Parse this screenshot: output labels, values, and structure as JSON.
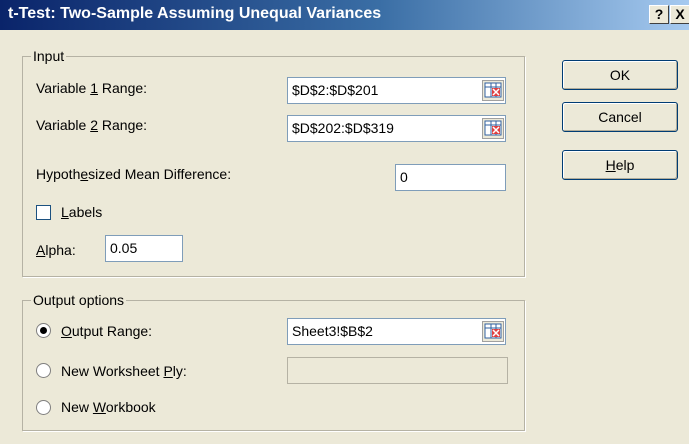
{
  "window": {
    "title": "t-Test: Two-Sample Assuming Unequal Variances",
    "help_glyph": "?",
    "close_glyph": "X"
  },
  "input": {
    "legend": "Input",
    "var1": {
      "pre": "Variable ",
      "key": "1",
      "post": " Range:",
      "value": "$D$2:$D$201"
    },
    "var2": {
      "pre": "Variable ",
      "key": "2",
      "post": " Range:",
      "value": "$D$202:$D$319"
    },
    "hyp": {
      "pre": "Hypoth",
      "key": "e",
      "post": "sized Mean Difference:",
      "value": "0"
    },
    "labels": {
      "key": "L",
      "post": "abels",
      "checked": false
    },
    "alpha": {
      "key": "A",
      "post": "lpha:",
      "value": "0.05"
    }
  },
  "output": {
    "legend": "Output options",
    "range": {
      "key": "O",
      "post": "utput Range:",
      "value": "Sheet3!$B$2",
      "selected": true
    },
    "worksheet": {
      "pre": "New Worksheet ",
      "key": "P",
      "post": "ly:",
      "value": ""
    },
    "workbook": {
      "pre": "New ",
      "key": "W",
      "post": "orkbook"
    }
  },
  "buttons": {
    "ok": "OK",
    "cancel": "Cancel",
    "help_key": "H",
    "help_post": "elp"
  },
  "icons": {
    "range_picker": "range-select-icon"
  },
  "colors": {
    "title_start": "#0a246a",
    "title_end": "#a6caf0",
    "face": "#ece9d8"
  }
}
